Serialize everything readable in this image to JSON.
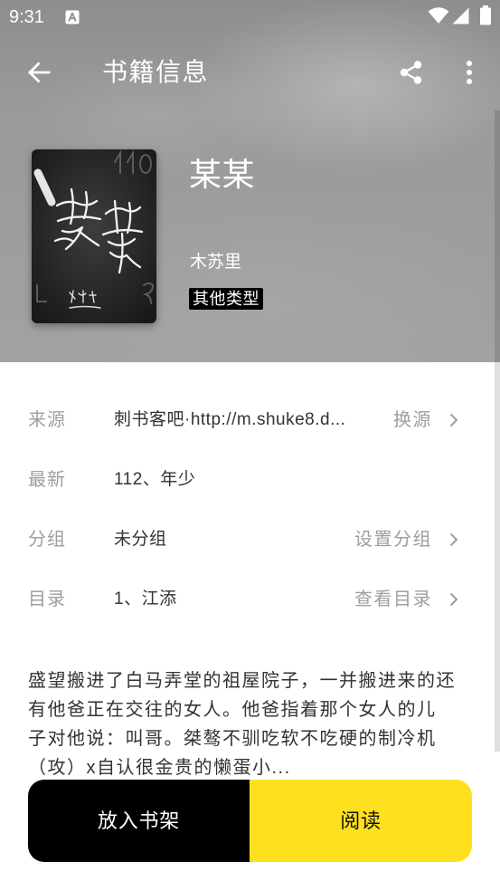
{
  "status_bar": {
    "time": "9:31",
    "icons": [
      "a-notification-icon",
      "wifi-icon",
      "cellular-signal-icon",
      "battery-icon"
    ]
  },
  "toolbar": {
    "title": "书籍信息",
    "icons": {
      "back": "arrow-back-icon",
      "share": "share-icon",
      "more": "more-vert-icon"
    }
  },
  "book": {
    "title": "某某",
    "author": "木苏里",
    "category": "其他类型"
  },
  "info_rows": [
    {
      "label": "来源",
      "value": "刺书客吧·http://m.shuke8.d...",
      "action": "换源"
    },
    {
      "label": "最新",
      "value": "112、年少"
    },
    {
      "label": "分组",
      "value": "未分组",
      "action": "设置分组"
    },
    {
      "label": "目录",
      "value": "1、江添",
      "action": "查看目录"
    }
  ],
  "description_lines": [
    "盛望搬进了白马弄堂的祖屋院子，一并搬进来的还",
    "有他爸正在交往的女人。他爸指着那个女人的儿",
    "子对他说：叫哥。桀骜不驯吃软不吃硬的制冷机",
    "（攻）x自认很金贵的懒蛋小..."
  ],
  "buttons": {
    "add_to_shelf": "放入书架",
    "read": "阅读"
  },
  "colors": {
    "header_backdrop": "#9c9c9c",
    "label_gray": "#9e9e9e",
    "text_dark": "#333333",
    "button_black": "#000000",
    "button_yellow": "#FFE01F",
    "tag_background": "#000000"
  }
}
